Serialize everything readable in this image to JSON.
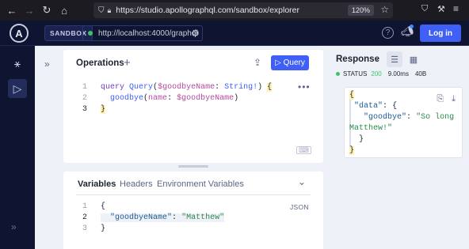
{
  "browser": {
    "url": "https://studio.apollographql.com/sandbox/explorer",
    "zoom": "120%"
  },
  "header": {
    "logo_letter": "A",
    "sandbox_label": "SANDBOX",
    "endpoint": "http://localhost:4000/graphql",
    "help": "?",
    "login_label": "Log in"
  },
  "operations": {
    "title": "Operations",
    "add_symbol": "+",
    "run_label": "Query",
    "more": "•••",
    "lines": [
      {
        "num": "1",
        "code": ""
      },
      {
        "num": "2",
        "code": ""
      },
      {
        "num": "3",
        "code": ""
      }
    ],
    "q_keyword": "query",
    "q_name": "Query",
    "q_open": "(",
    "q_var": "$goodbyeName",
    "q_colon": ":",
    "q_type": "String!",
    "q_close": ")",
    "q_brace": "{",
    "f_name": "goodbye",
    "f_open": "(",
    "f_arg": "name",
    "f_colon": ":",
    "f_var": "$goodbyeName",
    "f_close": ")",
    "end_brace": "}"
  },
  "variables": {
    "tabs": [
      {
        "label": "Variables"
      },
      {
        "label": "Headers"
      },
      {
        "label": "Environment Variables"
      }
    ],
    "json_tag": "JSON",
    "lines": [
      {
        "num": "1"
      },
      {
        "num": "2"
      },
      {
        "num": "3"
      }
    ],
    "open_brace": "{",
    "key": "\"goodbyeName\"",
    "colon": ":",
    "value": "\"Matthew\"",
    "close_brace": "}"
  },
  "response": {
    "title": "Response",
    "status_label": "STATUS",
    "status_code": "200",
    "time": "9.00ms",
    "size": "40B",
    "open_brace": "{",
    "data_key": "\"data\"",
    "colon": ":",
    "data_open": "{",
    "goodbye_key": "\"goodbye\"",
    "goodbye_colon": ":",
    "goodbye_value_1": "\"So long",
    "goodbye_value_2": "Matthew!\"",
    "data_close": "}",
    "close_brace": "}"
  },
  "colors": {
    "header_bg": "#0f1430",
    "accent": "#3f5ff5",
    "status_green": "#3cc46d"
  }
}
